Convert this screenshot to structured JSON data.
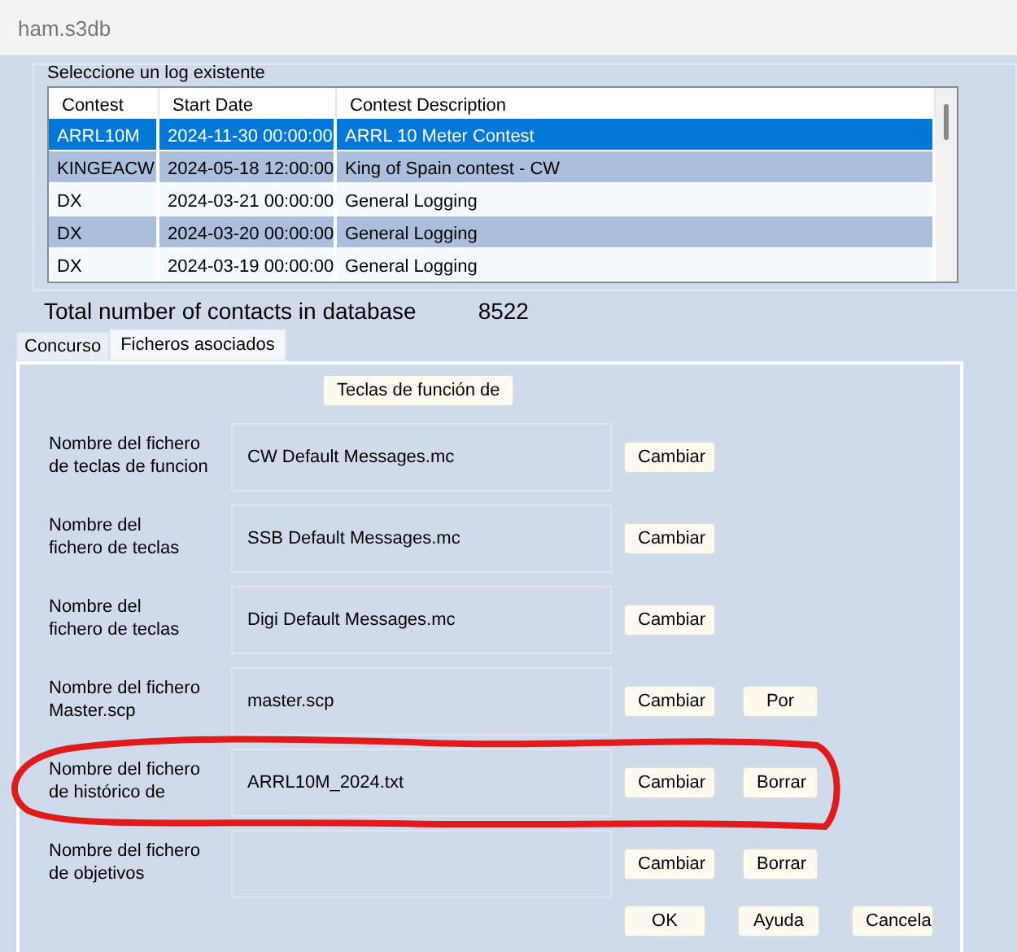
{
  "window": {
    "title": "ham.s3db"
  },
  "log_group": {
    "label": "Seleccione un log existente",
    "columns": [
      "Contest",
      "Start Date",
      "Contest Description"
    ],
    "rows": [
      {
        "cells": [
          "ARRL10M",
          "2024-11-30 00:00:00",
          "ARRL 10 Meter Contest"
        ],
        "selected": true
      },
      {
        "cells": [
          "KINGEACW",
          "2024-05-18 12:00:00",
          "King of Spain contest - CW"
        ],
        "selected": false
      },
      {
        "cells": [
          "DX",
          "2024-03-21 00:00:00",
          "General Logging"
        ],
        "selected": false
      },
      {
        "cells": [
          "DX",
          "2024-03-20 00:00:00",
          "General Logging"
        ],
        "selected": false
      },
      {
        "cells": [
          "DX",
          "2024-03-19 00:00:00",
          "General Logging"
        ],
        "selected": false
      }
    ]
  },
  "total": {
    "label": "Total number of contacts in database",
    "value": "8522"
  },
  "tabs": [
    {
      "label": "Concurso",
      "selected": false
    },
    {
      "label": "Ficheros asociados",
      "selected": true
    }
  ],
  "panel": {
    "header_button": "Teclas de función de",
    "files": [
      {
        "label": "Nombre del fichero\nde teclas de funcion",
        "value": "CW Default Messages.mc",
        "buttons": [
          "Cambiar"
        ],
        "circled": false
      },
      {
        "label": "Nombre del\nfichero de teclas",
        "value": "SSB Default Messages.mc",
        "buttons": [
          "Cambiar"
        ],
        "circled": false
      },
      {
        "label": "Nombre del\nfichero de teclas",
        "value": "Digi Default Messages.mc",
        "buttons": [
          "Cambiar"
        ],
        "circled": false
      },
      {
        "label": "Nombre del fichero\nMaster.scp",
        "value": "master.scp",
        "buttons": [
          "Cambiar",
          "Por"
        ],
        "circled": false
      },
      {
        "label": "Nombre del fichero\nde histórico de",
        "value": "ARRL10M_2024.txt",
        "buttons": [
          "Cambiar",
          "Borrar"
        ],
        "circled": true
      },
      {
        "label": "Nombre del fichero\nde objetivos",
        "buttons": [
          "Cambiar",
          "Borrar"
        ],
        "circled": false
      }
    ],
    "footer_buttons": [
      "OK",
      "Ayuda",
      "Cancela"
    ]
  }
}
